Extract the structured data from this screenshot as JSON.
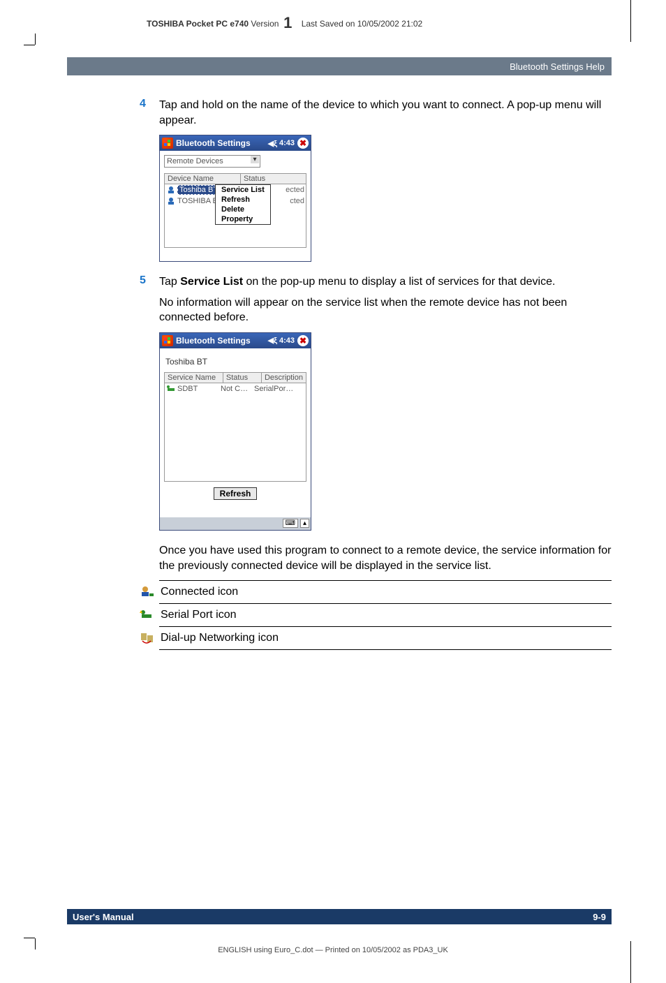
{
  "header": {
    "product": "TOSHIBA Pocket PC e740",
    "version_label": "Version",
    "version_num": "1",
    "saved": "Last Saved on 10/05/2002 21:02"
  },
  "breadcrumb": "Bluetooth Settings Help",
  "step4": {
    "num": "4",
    "text": "Tap and hold on the name of the device to which you want to connect. A pop-up menu will appear."
  },
  "shot1": {
    "title": "Bluetooth Settings",
    "time": "4:43",
    "combo": "Remote Devices",
    "col1": "Device Name",
    "col2": "Status",
    "row1": {
      "name": "Toshiba BT",
      "status": "ected"
    },
    "row2": {
      "name": "TOSHIBA B",
      "status": "cted"
    },
    "menu": [
      "Service List",
      "Refresh",
      "Delete",
      "Property"
    ]
  },
  "step5": {
    "num": "5",
    "text_a": "Tap ",
    "text_bold": "Service List",
    "text_b": " on the pop-up menu to display a list of services for that device.",
    "text2": "No information will appear on the service list when the remote device has not been connected before."
  },
  "shot2": {
    "title": "Bluetooth Settings",
    "time": "4:43",
    "label": "Toshiba BT",
    "col1": "Service Name",
    "col2": "Status",
    "col3": "Description",
    "row": {
      "name": "SDBT",
      "status": "Not C…",
      "desc": "SerialPor…"
    },
    "refresh": "Refresh"
  },
  "after_text": "Once you have used this program to connect to a remote device, the service information for the previously connected device will be displayed in the service list.",
  "legend": {
    "l1": "Connected icon",
    "l2": "Serial Port icon",
    "l3": "Dial-up Networking icon"
  },
  "footer": {
    "left": "User's Manual",
    "right": "9-9"
  },
  "print_line": "ENGLISH using  Euro_C.dot — Printed on 10/05/2002 as PDA3_UK"
}
